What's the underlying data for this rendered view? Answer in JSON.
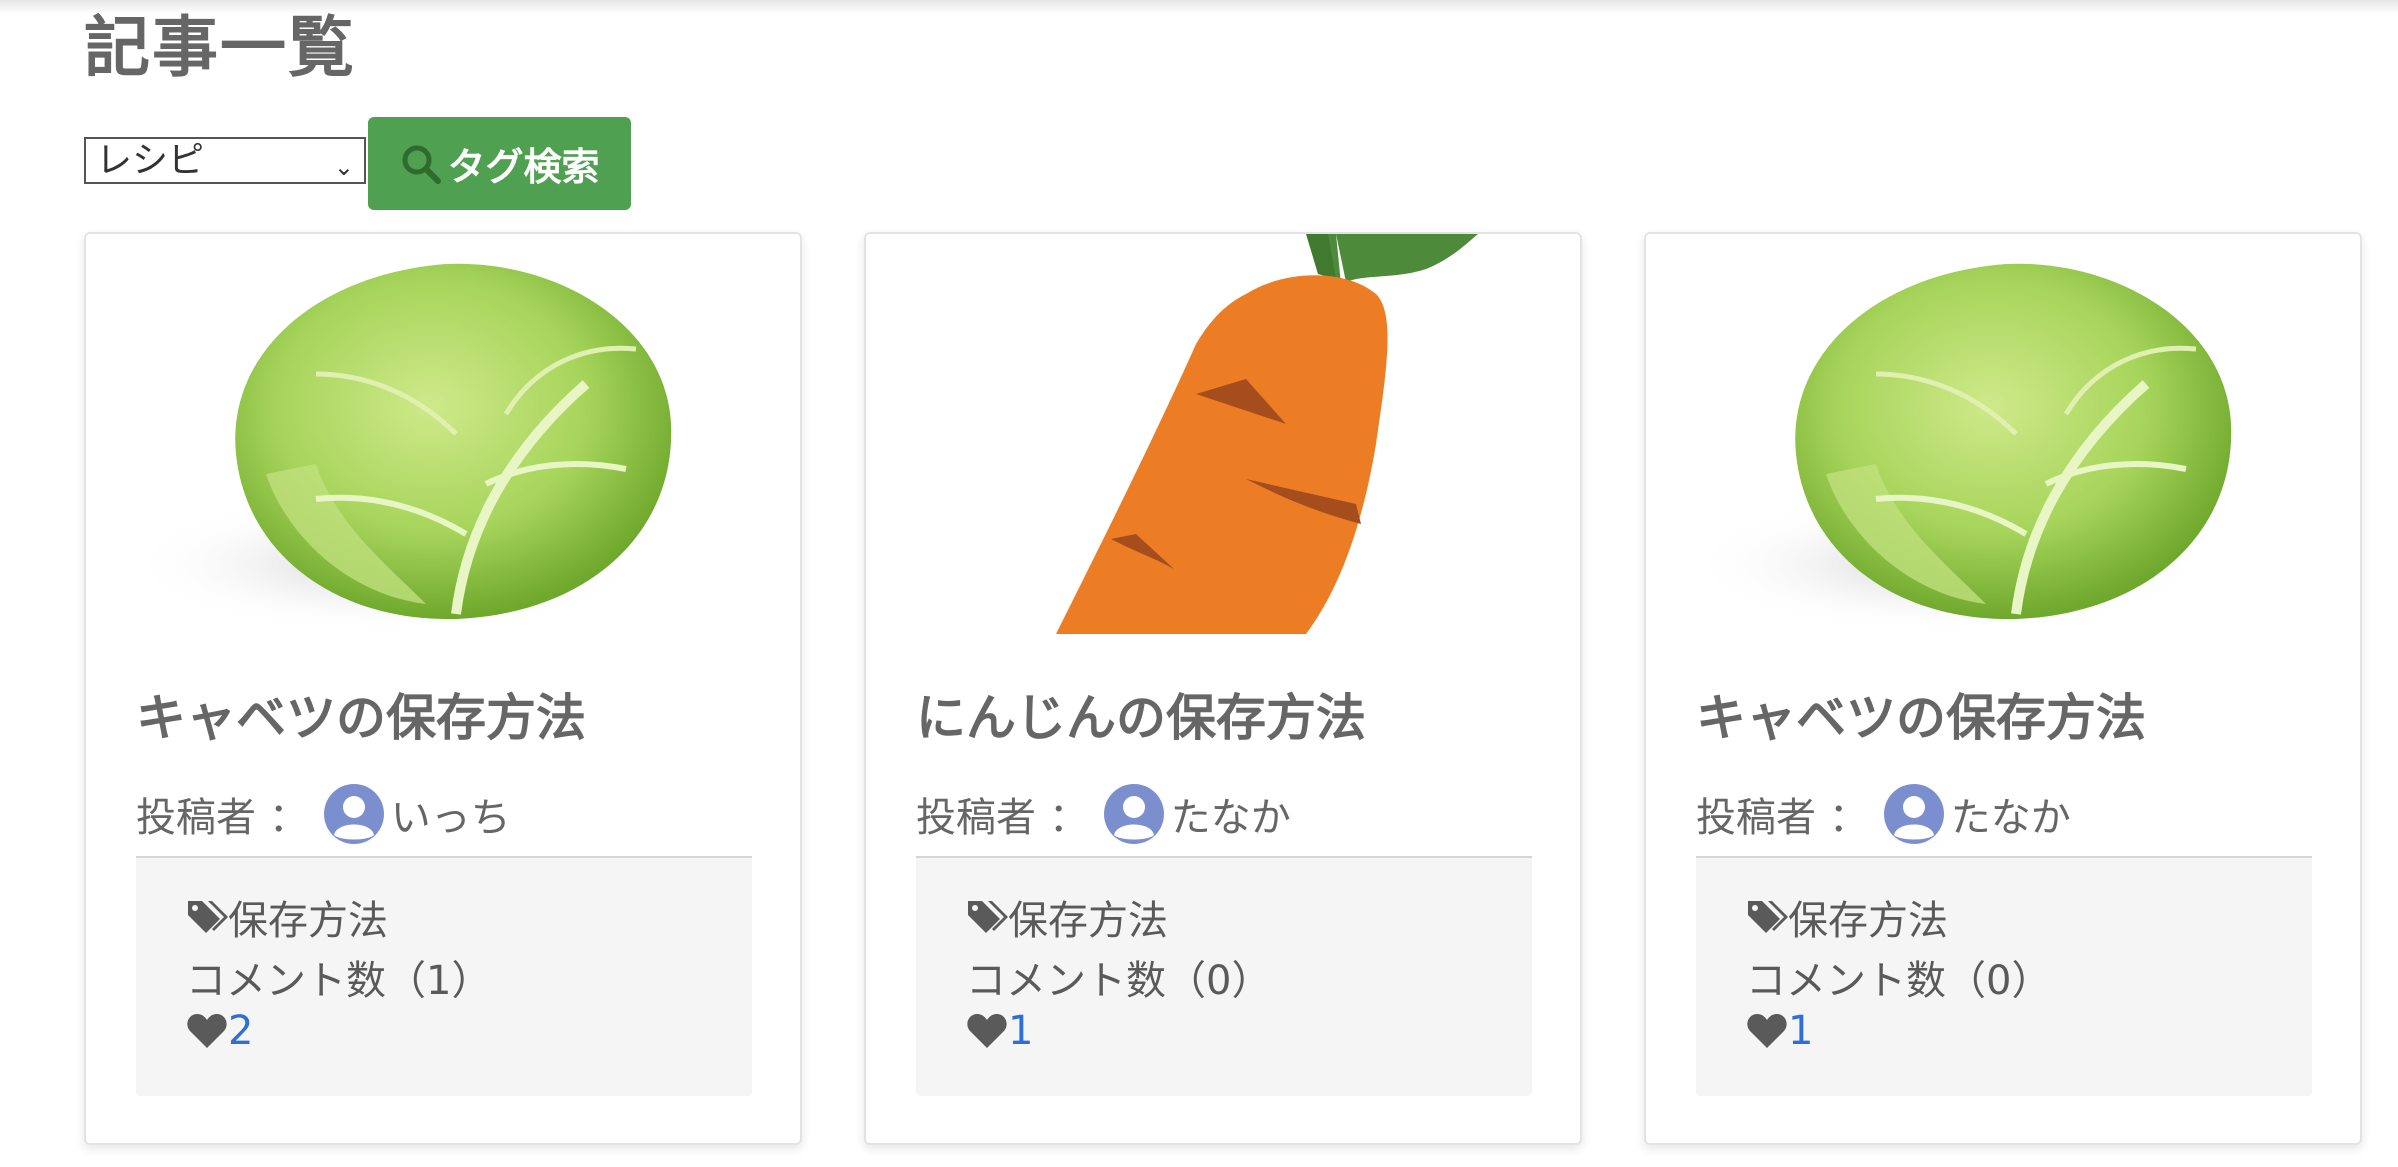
{
  "page": {
    "title": "記事一覧"
  },
  "filter": {
    "selected_tag": "レシピ",
    "search_label": "タグ検索"
  },
  "colors": {
    "accent": "#4fa050",
    "link": "#2d6fd6",
    "text": "#666666",
    "footer_bg": "#f5f5f5"
  },
  "articles": [
    {
      "image": "cabbage-image",
      "title": "キャベツの保存方法",
      "author_label": "投稿者 ：",
      "author": "いっち",
      "tag": "保存方法",
      "comments": "コメント数（1）",
      "likes": "2"
    },
    {
      "image": "carrot-image",
      "title": "にんじんの保存方法",
      "author_label": "投稿者 ：",
      "author": "たなか",
      "tag": "保存方法",
      "comments": "コメント数（0）",
      "likes": "1"
    },
    {
      "image": "cabbage-image",
      "title": "キャベツの保存方法",
      "author_label": "投稿者 ：",
      "author": "たなか",
      "tag": "保存方法",
      "comments": "コメント数（0）",
      "likes": "1"
    }
  ]
}
